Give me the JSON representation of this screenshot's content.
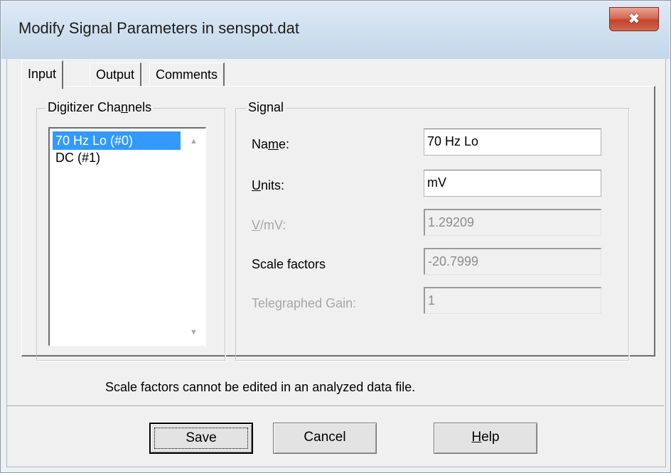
{
  "window": {
    "title": "Modify Signal Parameters in senspot.dat",
    "close_glyph": "✖"
  },
  "tabs": [
    {
      "label": "Input",
      "active": true
    },
    {
      "label": "Output",
      "active": false
    },
    {
      "label": "Comments",
      "active": false
    }
  ],
  "channels_group": {
    "label_before": "Digitizer Cha",
    "label_accel": "n",
    "label_after": "nels",
    "items": [
      {
        "label": "70 Hz Lo (#0)",
        "selected": true
      },
      {
        "label": "DC (#1)",
        "selected": false
      }
    ],
    "scroll_up_glyph": "▲",
    "scroll_down_glyph": "▼"
  },
  "signal_group": {
    "label": "Signal",
    "name": {
      "label_before": "Na",
      "label_accel": "m",
      "label_after": "e:",
      "value": "70 Hz Lo"
    },
    "units": {
      "label_accel": "U",
      "label_after": "nits:",
      "value": "mV"
    },
    "v_per_mv": {
      "label_accel": "V",
      "label_after": "/mV:",
      "value": "1.29209"
    },
    "scale_factors": {
      "label": "Scale factors",
      "value": "-20.7999"
    },
    "telegraphed_gain": {
      "label": "Telegraphed Gain:",
      "value": "1"
    }
  },
  "status_message": "Scale factors cannot be edited in an analyzed data file.",
  "buttons": {
    "save": "Save",
    "cancel": "Cancel",
    "help_accel": "H",
    "help_after": "elp"
  },
  "colors": {
    "selection": "#3399ff",
    "close_button": "#c2442c"
  }
}
